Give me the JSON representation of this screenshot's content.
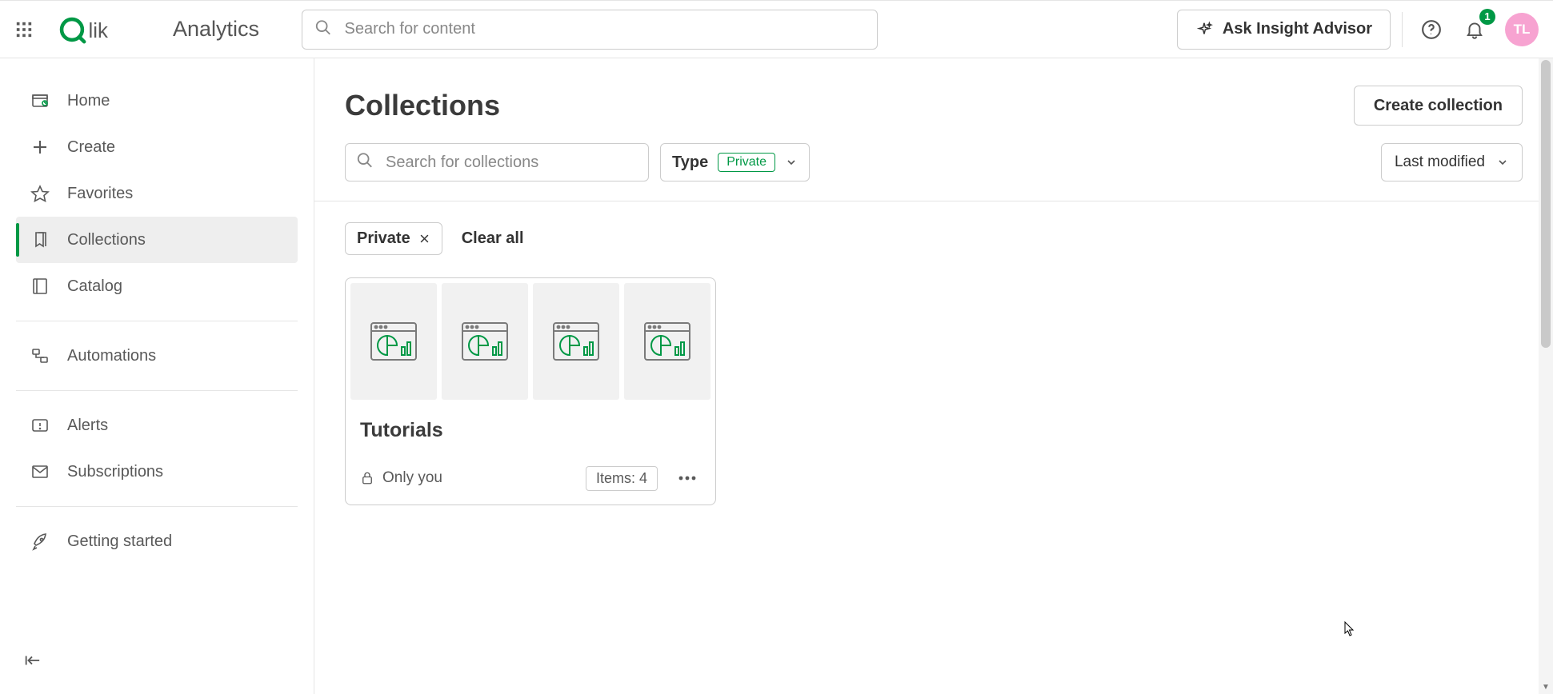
{
  "header": {
    "product": "Analytics",
    "search_placeholder": "Search for content",
    "ask_label": "Ask Insight Advisor",
    "notification_badge": "1",
    "avatar_initials": "TL"
  },
  "sidebar": {
    "items": [
      {
        "key": "home",
        "label": "Home"
      },
      {
        "key": "create",
        "label": "Create"
      },
      {
        "key": "favorites",
        "label": "Favorites"
      },
      {
        "key": "collections",
        "label": "Collections"
      },
      {
        "key": "catalog",
        "label": "Catalog"
      },
      {
        "key": "automations",
        "label": "Automations"
      },
      {
        "key": "alerts",
        "label": "Alerts"
      },
      {
        "key": "subscriptions",
        "label": "Subscriptions"
      },
      {
        "key": "getting_started",
        "label": "Getting started"
      }
    ],
    "active": "collections"
  },
  "page": {
    "title": "Collections",
    "create_button": "Create collection",
    "collection_search_placeholder": "Search for collections",
    "type_filter": {
      "label": "Type",
      "selected": "Private"
    },
    "sort_label": "Last modified",
    "applied_filters": [
      {
        "label": "Private"
      }
    ],
    "clear_all": "Clear all",
    "cards": [
      {
        "title": "Tutorials",
        "privacy": "Only you",
        "item_count_label": "Items: 4",
        "thumb_count": 4
      }
    ]
  }
}
